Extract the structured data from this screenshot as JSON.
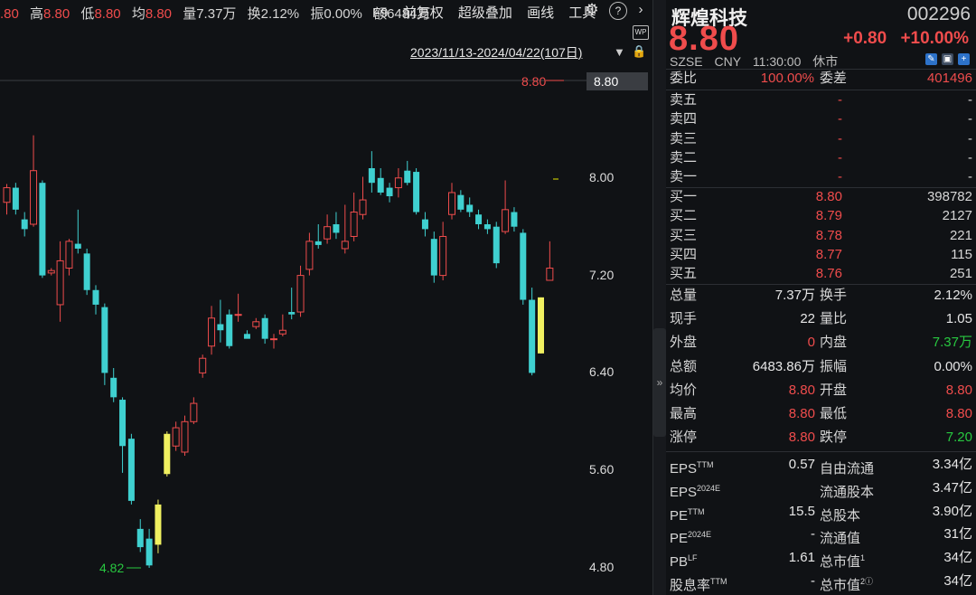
{
  "info": {
    "partial": ".80",
    "high_label": "高",
    "high": "8.80",
    "low_label": "低",
    "low": "8.80",
    "avg_label": "均",
    "avg": "8.80",
    "vol_label": "量",
    "vol": "7.37万",
    "turn_label": "换",
    "turn": "2.12%",
    "amp_label": "振",
    "amp": "0.00%",
    "amt_label": "额",
    "amt": "6484万"
  },
  "toolbar": {
    "f9": "F9",
    "fq": "前复权",
    "overlay": "超级叠加",
    "draw": "画线",
    "tools": "工具"
  },
  "range": "2023/11/13-2024/04/22(107日)",
  "axis": {
    "ticks": [
      "8.80",
      "8.00",
      "7.20",
      "6.40",
      "5.60",
      "4.80"
    ],
    "current": "8.80",
    "max_label": "8.80",
    "min_label": "4.82"
  },
  "stock": {
    "name": "辉煌科技",
    "code": "002296",
    "price": "8.80",
    "change": "+0.80",
    "pct": "+10.00%",
    "exchange": "SZSE",
    "currency": "CNY",
    "time": "11:30:00",
    "status": "休市"
  },
  "weibi": {
    "label": "委比",
    "value": "100.00%",
    "label2": "委差",
    "value2": "401496"
  },
  "asks": [
    {
      "label": "卖五",
      "price": "-",
      "vol": "-"
    },
    {
      "label": "卖四",
      "price": "-",
      "vol": "-"
    },
    {
      "label": "卖三",
      "price": "-",
      "vol": "-"
    },
    {
      "label": "卖二",
      "price": "-",
      "vol": "-"
    },
    {
      "label": "卖一",
      "price": "-",
      "vol": "-"
    }
  ],
  "bids": [
    {
      "label": "买一",
      "price": "8.80",
      "vol": "398782"
    },
    {
      "label": "买二",
      "price": "8.79",
      "vol": "2127"
    },
    {
      "label": "买三",
      "price": "8.78",
      "vol": "221"
    },
    {
      "label": "买四",
      "price": "8.77",
      "vol": "115"
    },
    {
      "label": "买五",
      "price": "8.76",
      "vol": "251"
    }
  ],
  "stats": [
    {
      "l1": "总量",
      "v1": "7.37万",
      "c1": "white",
      "l2": "换手",
      "v2": "2.12%",
      "c2": "white"
    },
    {
      "l1": "现手",
      "v1": "22",
      "c1": "white",
      "l2": "量比",
      "v2": "1.05",
      "c2": "white"
    },
    {
      "l1": "外盘",
      "v1": "0",
      "c1": "red",
      "l2": "内盘",
      "v2": "7.37万",
      "c2": "green"
    },
    {
      "l1": "总额",
      "v1": "6483.86万",
      "c1": "white",
      "l2": "振幅",
      "v2": "0.00%",
      "c2": "white"
    },
    {
      "l1": "均价",
      "v1": "8.80",
      "c1": "red",
      "l2": "开盘",
      "v2": "8.80",
      "c2": "red"
    },
    {
      "l1": "最高",
      "v1": "8.80",
      "c1": "red",
      "l2": "最低",
      "v2": "8.80",
      "c2": "red"
    },
    {
      "l1": "涨停",
      "v1": "8.80",
      "c1": "red",
      "l2": "跌停",
      "v2": "7.20",
      "c2": "green"
    }
  ],
  "fund": [
    {
      "l1": "EPS",
      "s1": "TTM",
      "v1": "0.57",
      "l2": "自由流通",
      "s2": "",
      "v2": "3.34亿"
    },
    {
      "l1": "EPS",
      "s1": "2024E",
      "v1": "",
      "l2": "流通股本",
      "s2": "",
      "v2": "3.47亿"
    },
    {
      "l1": "PE",
      "s1": "TTM",
      "v1": "15.5",
      "l2": "总股本",
      "s2": "",
      "v2": "3.90亿"
    },
    {
      "l1": "PE",
      "s1": "2024E",
      "v1": "-",
      "l2": "流通值",
      "s2": "",
      "v2": "31亿"
    },
    {
      "l1": "PB",
      "s1": "LF",
      "v1": "1.61",
      "l2": "总市值",
      "s2": "1",
      "v2": "34亿"
    },
    {
      "l1": "股息率",
      "s1": "TTM",
      "v1": "-",
      "l2": "总市值",
      "s2": "2ⓘ",
      "v2": "34亿"
    }
  ],
  "chart_data": {
    "type": "candlestick",
    "ylim": [
      4.8,
      8.8
    ],
    "yticks": [
      8.8,
      8.0,
      7.2,
      6.4,
      5.6,
      4.8
    ],
    "up_color": "#ef4c4c",
    "down_color": "#3fd0d0",
    "limit_color": "#f0f060",
    "candles": [
      [
        7.8,
        7.92,
        7.95,
        7.7
      ],
      [
        7.92,
        7.74,
        7.96,
        7.7
      ],
      [
        7.66,
        7.58,
        7.72,
        7.52
      ],
      [
        7.62,
        8.06,
        8.35,
        7.6
      ],
      [
        7.96,
        7.2,
        7.98,
        7.18
      ],
      [
        7.22,
        7.24,
        7.26,
        7.2
      ],
      [
        6.96,
        7.32,
        7.48,
        6.82
      ],
      [
        7.26,
        7.48,
        7.5,
        7.2
      ],
      [
        7.46,
        7.42,
        7.74,
        7.38
      ],
      [
        7.38,
        7.08,
        7.42,
        7.04
      ],
      [
        7.08,
        6.96,
        7.12,
        6.88
      ],
      [
        6.94,
        6.4,
        6.97,
        6.3
      ],
      [
        6.36,
        6.2,
        6.44,
        6.16
      ],
      [
        6.18,
        5.8,
        6.2,
        5.58
      ],
      [
        5.86,
        5.35,
        5.9,
        5.32
      ],
      [
        5.12,
        4.97,
        5.2,
        4.93
      ],
      [
        5.04,
        4.82,
        5.12,
        4.8
      ],
      [
        4.99,
        5.32,
        5.36,
        4.92
      ],
      [
        5.57,
        5.9,
        5.92,
        5.55
      ],
      [
        5.8,
        5.95,
        6.0,
        5.76
      ],
      [
        5.75,
        6.0,
        6.05,
        5.72
      ],
      [
        6.0,
        6.15,
        6.2,
        5.98
      ],
      [
        6.4,
        6.52,
        6.55,
        6.36
      ],
      [
        6.62,
        6.85,
        6.95,
        6.55
      ],
      [
        6.8,
        6.75,
        7.0,
        6.65
      ],
      [
        6.88,
        6.62,
        6.92,
        6.6
      ],
      [
        6.88,
        6.88,
        7.05,
        6.82
      ],
      [
        6.72,
        6.68,
        6.75,
        6.7
      ],
      [
        6.78,
        6.82,
        6.85,
        6.76
      ],
      [
        6.85,
        6.68,
        6.88,
        6.64
      ],
      [
        6.68,
        6.68,
        6.72,
        6.6
      ],
      [
        6.72,
        6.75,
        6.88,
        6.7
      ],
      [
        6.9,
        6.88,
        7.1,
        6.84
      ],
      [
        6.9,
        7.2,
        7.28,
        6.86
      ],
      [
        7.25,
        7.48,
        7.55,
        7.2
      ],
      [
        7.48,
        7.45,
        7.62,
        7.42
      ],
      [
        7.5,
        7.6,
        7.7,
        7.46
      ],
      [
        7.62,
        7.55,
        7.72,
        7.5
      ],
      [
        7.42,
        7.48,
        7.78,
        7.38
      ],
      [
        7.52,
        7.72,
        7.88,
        7.48
      ],
      [
        7.7,
        7.82,
        8.01,
        7.66
      ],
      [
        8.08,
        7.96,
        8.22,
        7.88
      ],
      [
        8.0,
        7.88,
        8.08,
        7.86
      ],
      [
        7.92,
        7.85,
        7.96,
        7.8
      ],
      [
        7.92,
        8.0,
        8.08,
        7.84
      ],
      [
        8.06,
        7.96,
        8.14,
        7.94
      ],
      [
        8.05,
        7.72,
        8.08,
        7.7
      ],
      [
        7.66,
        7.58,
        7.72,
        7.52
      ],
      [
        7.5,
        7.2,
        7.56,
        7.14
      ],
      [
        7.2,
        7.52,
        7.64,
        7.16
      ],
      [
        7.7,
        7.88,
        7.96,
        7.66
      ],
      [
        7.86,
        7.74,
        7.9,
        7.72
      ],
      [
        7.78,
        7.72,
        7.84,
        7.68
      ],
      [
        7.7,
        7.62,
        7.74,
        7.58
      ],
      [
        7.62,
        7.58,
        7.66,
        7.54
      ],
      [
        7.6,
        7.3,
        7.64,
        7.26
      ],
      [
        7.56,
        7.74,
        7.98,
        7.54
      ],
      [
        7.72,
        7.6,
        7.76,
        7.56
      ],
      [
        7.55,
        7.0,
        7.58,
        6.96
      ],
      [
        7.0,
        6.4,
        7.1,
        6.38
      ],
      [
        6.56,
        7.02,
        7.02,
        6.56
      ],
      [
        7.16,
        7.26,
        7.48,
        7.16
      ]
    ],
    "limit_up_indices": [
      17,
      18,
      60
    ]
  }
}
